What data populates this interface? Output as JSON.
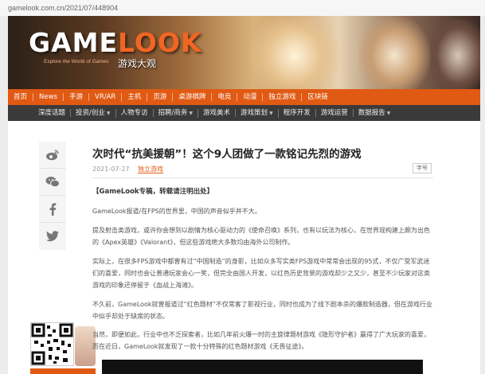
{
  "url": "gamelook.com.cn/2021/07/448904",
  "banner": {
    "logo_game": "GAME",
    "logo_look": "LOOK",
    "tagline": "Explore the World of Games",
    "cn_name": "游戏大观"
  },
  "nav_primary": [
    "首页",
    "News",
    "手游",
    "VR/AR",
    "主机",
    "页游",
    "桌游棋牌",
    "电竞",
    "动漫",
    "独立游戏",
    "区块链"
  ],
  "nav_secondary": [
    {
      "label": "深度话题",
      "dropdown": false
    },
    {
      "label": "投资/创业",
      "dropdown": true
    },
    {
      "label": "人物专访",
      "dropdown": false
    },
    {
      "label": "招聘/商务",
      "dropdown": true
    },
    {
      "label": "游戏美术",
      "dropdown": false
    },
    {
      "label": "游戏策划",
      "dropdown": true
    },
    {
      "label": "程序开发",
      "dropdown": false
    },
    {
      "label": "游戏运营",
      "dropdown": false
    },
    {
      "label": "数据报告",
      "dropdown": true
    }
  ],
  "article": {
    "title": "次时代“抗美援朝”！这个9人团做了一款铭记先烈的游戏",
    "date": "2021-07-27",
    "category": "独立游戏",
    "font_button": "字号",
    "notice": "【GameLook专稿，转载请注明出处】",
    "paragraphs": [
      "GameLook报道/在FPS的世界里，中国的声音似乎并不大。",
      "提及射击类游戏，或许你会想到以剧情为核心驱动力的《使命召唤》系列，也有以玩法为核心，在世界观构建上颇为出色的《Apex英雄》《Valorant》，但这些游戏绝大多数均由海外公司制作。",
      "实际上，在很多FPS游戏中都曾有过“中国制造”的身影，比如众多写实类FPS游戏中常常会出现的95式，不仅广受军武迷们的喜爱，同时也会让普通玩家会心一笑，但完全由国人开发，以红色历史背景的游戏却少之又少，甚至不少玩家对这类游戏的印象还停留于《血战上海滩》。",
      "不久前，GameLook就曾报道过“红色题材”不仅常客了影视行业，同时也成为了线下剧本杀的爆款制造器，但在游戏行业中似乎却处于缺席的状态。",
      "当然，即便如此，行业中也不乏探索者，比如几年前火爆一时的主旋律题材游戏《隐形守护者》赢得了广大玩家的喜爱，而在近日，GameLook就发现了一款十分特殊的红色题材游戏《无畏征途》。"
    ]
  },
  "icons": [
    "weibo-icon",
    "wechat-icon",
    "facebook-icon",
    "twitter-icon"
  ]
}
